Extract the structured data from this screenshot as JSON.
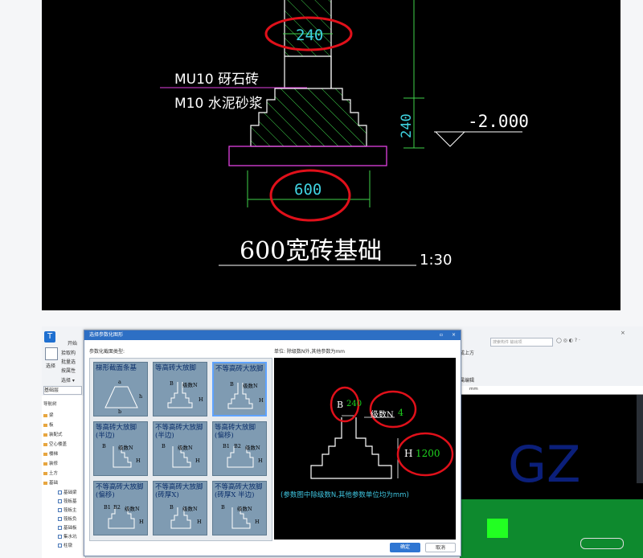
{
  "cad": {
    "wall_dim": "240",
    "material_1": "MU10 砑石砖",
    "material_2": "M10 水泥砂浆",
    "footing_dim": "240",
    "elevation": "-2.000",
    "width_dim": "600",
    "caption": "600宽砖基础",
    "scale": "1:30"
  },
  "app": {
    "tab_start": "开始",
    "select_label": "选择",
    "tools": [
      "拾取构",
      "批量选",
      "按属性"
    ],
    "select_dropdown": "选择 ▾",
    "floor_select": "基础层",
    "nav_title": "导航树",
    "nav_items": [
      "梁",
      "板",
      "装配式",
      "空心楼盖",
      "楼梯",
      "装修",
      "土方",
      "基础"
    ],
    "nav_sub": [
      "基础梁",
      "筏板基",
      "筏板主",
      "筏板负",
      "基础板",
      "集水坑",
      "柱墩"
    ],
    "right_label": "成上方",
    "edit_label": "属编辑",
    "unit": "mm",
    "search_placeholder": "搜索构件  输出项",
    "watermark": "GZ"
  },
  "dialog": {
    "title": "选择参数化图形",
    "type_label": "参数化截面类型:",
    "unit_note": "单位:  除级数N外,其他参数为mm",
    "thumbs": [
      {
        "title": "梯形截面条基",
        "labels": [
          "a",
          "h",
          "b"
        ]
      },
      {
        "title": "等高砖大放脚",
        "labels": [
          "B",
          "级数N",
          "H"
        ]
      },
      {
        "title": "不等高砖大放脚",
        "labels": [
          "B",
          "级数N",
          "H"
        ]
      },
      {
        "title": "等高砖大放脚(半边)",
        "labels": [
          "B",
          "级数N",
          "H"
        ]
      },
      {
        "title": "不等高砖大放脚(半边)",
        "labels": [
          "B",
          "级数N",
          "H"
        ]
      },
      {
        "title": "等高砖大放脚(偏移)",
        "labels": [
          "B1",
          "B2",
          "级数N",
          "H"
        ]
      },
      {
        "title": "不等高砖大放脚(偏移)",
        "labels": [
          "B1",
          "B2",
          "级数N",
          "H"
        ]
      },
      {
        "title": "不等高砖大放脚(砖厚X)",
        "labels": [
          "B",
          "级数N",
          "H"
        ]
      },
      {
        "title": "不等高砖大放脚(砖厚X 半边)",
        "labels": [
          "B",
          "级数N",
          "H"
        ]
      }
    ],
    "preview": {
      "b_label": "B",
      "b_value": "240",
      "n_label": "级数N",
      "n_value": "4",
      "h_label": "H",
      "h_value": "1200",
      "note": "(参数图中除级数N,其他参数单位均为mm)"
    },
    "ok_label": "确定",
    "cancel_label": "取消",
    "colors": {
      "title_bar": "#2d6fc4",
      "ok_button": "#2f76d2",
      "annotation": "#e0101a"
    }
  }
}
